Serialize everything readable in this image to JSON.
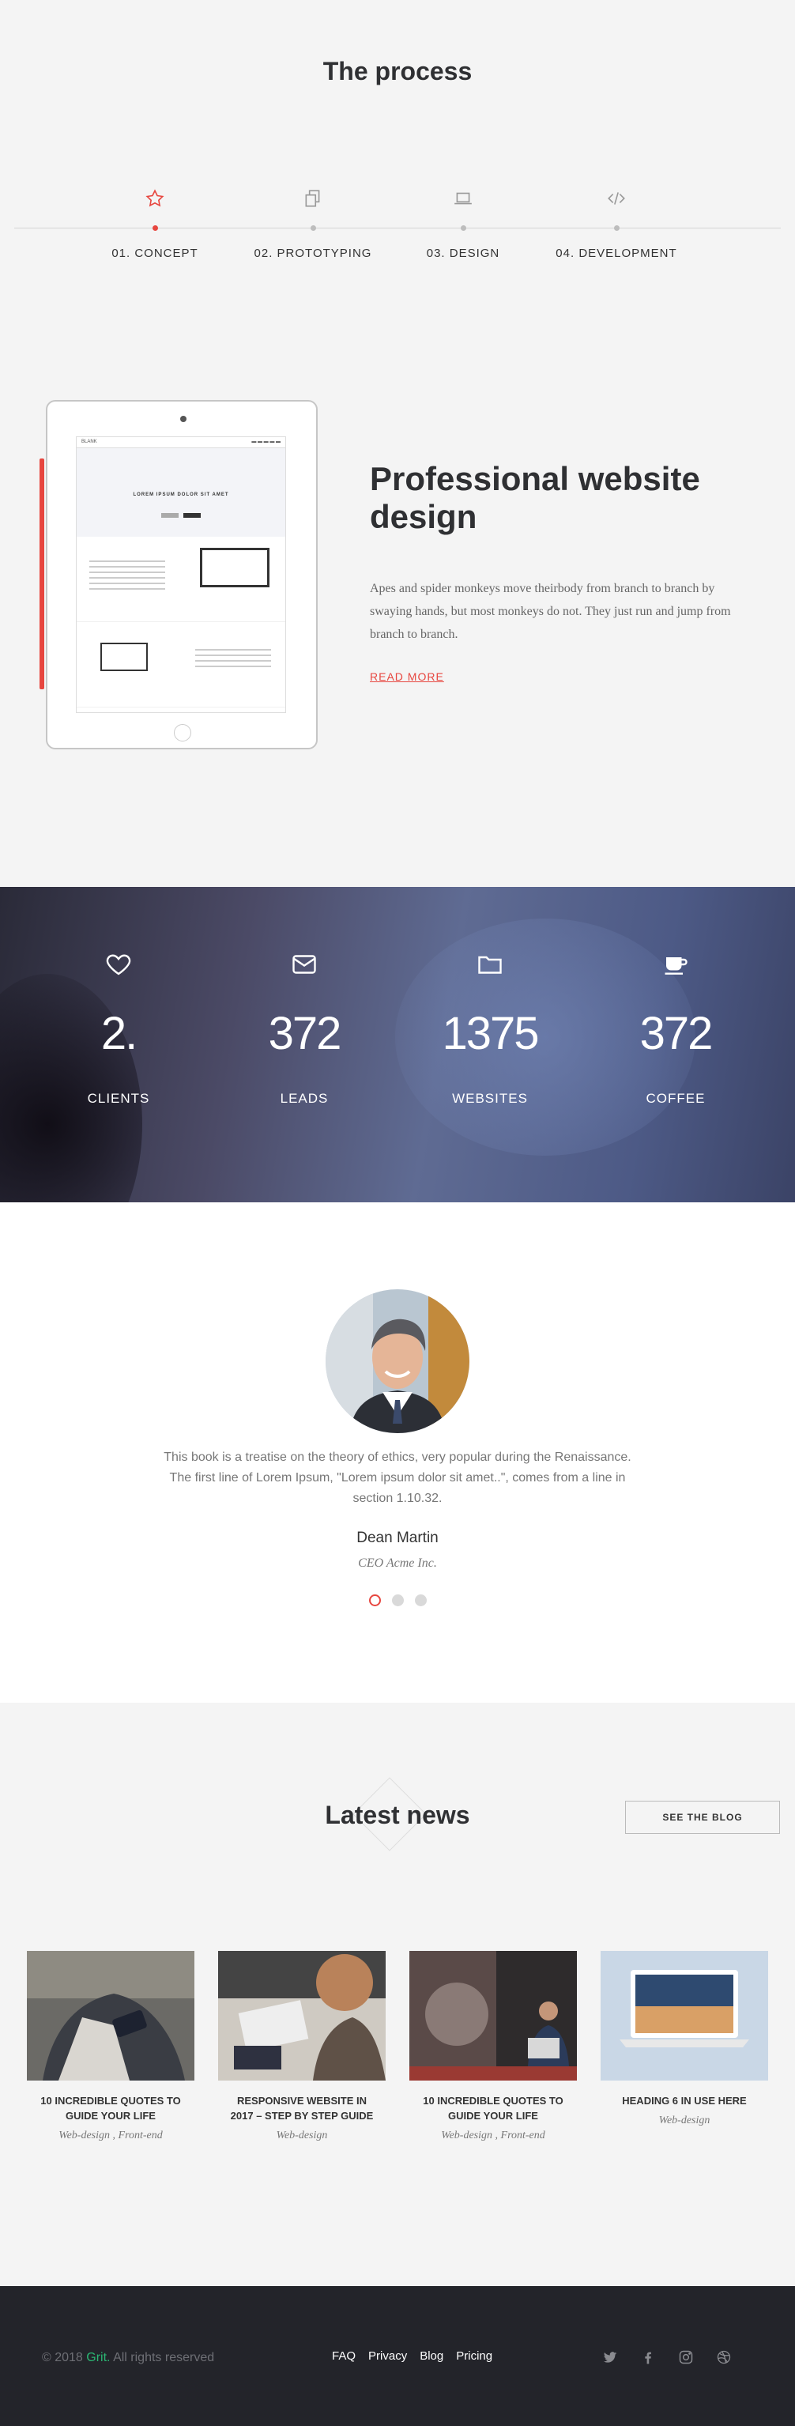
{
  "process": {
    "title": "The process",
    "steps": [
      {
        "label": "01. CONCEPT",
        "icon": "star-icon",
        "active": true
      },
      {
        "label": "02. PROTOTYPING",
        "icon": "copy-icon",
        "active": false
      },
      {
        "label": "03. DESIGN",
        "icon": "laptop-icon",
        "active": false
      },
      {
        "label": "04. DEVELOPMENT",
        "icon": "code-icon",
        "active": false
      }
    ]
  },
  "feature": {
    "title": "Professional website design",
    "text": "Apes and spider monkeys move theirbody from branch to branch by swaying hands, but most monkeys do not. They just run and jump from branch to branch.",
    "link": "READ MORE",
    "tablet": {
      "brand": "BLANK",
      "hero_title": "LOREM IPSUM DOLOR SIT AMET"
    }
  },
  "stats": [
    {
      "icon": "heart-icon",
      "value": "2.",
      "label": "CLIENTS"
    },
    {
      "icon": "envelope-icon",
      "value": "372",
      "label": "LEADS"
    },
    {
      "icon": "folder-icon",
      "value": "1375",
      "label": "WEBSITES"
    },
    {
      "icon": "coffee-icon",
      "value": "372",
      "label": "COFFEE"
    }
  ],
  "testimonial": {
    "quote": "This book is a treatise on the theory of ethics, very popular during the Renaissance. The first line of Lorem Ipsum, \"Lorem ipsum dolor sit amet..\", comes from a line in section 1.10.32.",
    "name": "Dean Martin",
    "role": "CEO Acme Inc.",
    "active_slide": 1,
    "slides": 3
  },
  "news": {
    "title": "Latest news",
    "button": "SEE THE BLOG",
    "posts": [
      {
        "title": "10 INCREDIBLE QUOTES TO GUIDE YOUR LIFE",
        "tags": "Web-design , Front-end"
      },
      {
        "title": "RESPONSIVE WEBSITE IN 2017 – STEP BY STEP GUIDE",
        "tags": "Web-design"
      },
      {
        "title": "10 INCREDIBLE QUOTES TO GUIDE YOUR LIFE",
        "tags": "Web-design , Front-end"
      },
      {
        "title": "HEADING 6 IN USE HERE",
        "tags": "Web-design"
      }
    ]
  },
  "footer": {
    "copyright_prefix": "© 2018 ",
    "brand": "Grit.",
    "copyright_suffix": " All rights reserved",
    "links": [
      "FAQ",
      "Privacy",
      "Blog",
      "Pricing"
    ],
    "socials": [
      "twitter-icon",
      "facebook-icon",
      "instagram-icon",
      "dribbble-icon"
    ]
  },
  "colors": {
    "accent": "#e7463f",
    "brand_green": "#2bb673",
    "footer_bg": "#23242a"
  }
}
